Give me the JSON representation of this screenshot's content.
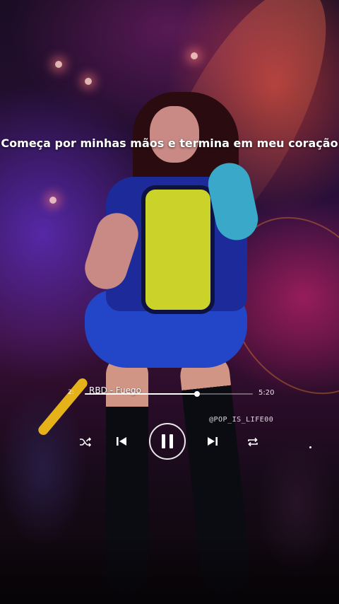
{
  "lyric": "Começa por minhas mãos e termina em meu coração",
  "player": {
    "song": "RBD - Fuego",
    "elapsed": "2:",
    "total": "5:20",
    "progress": 0.67
  },
  "watermark": "@POP_IS_LIFE00",
  "controls": {
    "shuffle_icon": "shuffle-icon",
    "prev_icon": "skip-previous-icon",
    "play_state": "pause-icon",
    "next_icon": "skip-next-icon",
    "repeat_icon": "repeat-icon"
  },
  "colors": {
    "text": "#ffffff",
    "track": "#ffffff"
  }
}
